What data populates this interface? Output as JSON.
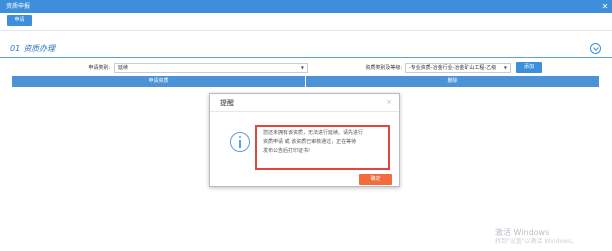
{
  "window": {
    "title": "资质申报"
  },
  "toolbar": {
    "apply_label": "申请"
  },
  "section": {
    "number": "01",
    "title": "资质办理"
  },
  "form": {
    "category_label": "申请类别:",
    "category_value": "延续",
    "qualification_label": "资质类别及等级:",
    "qualification_value": "-专业资质-冶金行业-冶金矿山工程-乙级",
    "add_label": "添加"
  },
  "table": {
    "columns": [
      "申请资质",
      "删除"
    ]
  },
  "dialog": {
    "title": "提醒",
    "close_glyph": "×",
    "message_lines": [
      "您还未拥有该资质，无法进行延续。请先进行",
      "资质申请 或 该资质已审核通过，正在等待",
      "发布公告后打印证书!"
    ],
    "confirm_label": "确定"
  },
  "watermark": {
    "line1": "激活 Windows",
    "line2": "转到\"设置\"以激活 Windows。"
  },
  "colors": {
    "primary": "#3d8fdb",
    "danger": "#e0463c",
    "confirm": "#f26c3c"
  }
}
